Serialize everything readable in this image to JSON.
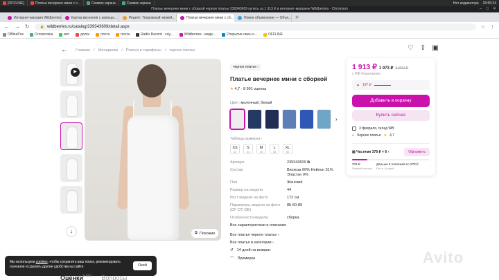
{
  "os": {
    "tasks": [
      "[OFFLINE]",
      "Платье вечернее мини с с...",
      "Снимок экрана",
      "Снимок экрана"
    ],
    "indicator": "Нет индикатора",
    "time": "18:55:24"
  },
  "window": {
    "title": "Платье вечернее мини с сборкой черное платье 239343609 купить за 1 913 ₽ в интернет-магазине Wildberries - Chromium"
  },
  "tabs": [
    {
      "label": "Интернет-магазин Wildberries"
    },
    {
      "label": "Куртка весенняя с капюшо..."
    },
    {
      "label": "Рецепт: Творожный чизкей..."
    },
    {
      "label": "Платье вечернее мини с сб..."
    },
    {
      "label": "Новое объявление — Объя..."
    }
  ],
  "address": {
    "url": "wildberries.ru/catalog/239343609/detail.aspx"
  },
  "bookmarks": [
    "OfflinePos",
    "Статистика",
    "вит",
    "долги",
    "почта",
    "почта",
    "Radio Record - слу...",
    "Wildberries - моде...",
    "Открытие смен о...",
    "OFFLINE"
  ],
  "breadcrumbs": [
    "Главная",
    "Женщинам",
    "Платья и сарафаны",
    "черное платье"
  ],
  "product": {
    "badge": "черное платье",
    "title": "Платье вечернее мини с сборкой",
    "rating": "4,7",
    "reviews": "8 991 оценка",
    "color_label": "Цвет:",
    "color_value": "молочный, белый",
    "swatch_colors": [
      "#eeeeee",
      "#243a62",
      "#1f2e52",
      "#5c7fb8",
      "#2e58b5",
      "#6fa6c8"
    ],
    "size_table": "Таблица размеров",
    "sizes": [
      {
        "label": "XS",
        "ru": "42"
      },
      {
        "label": "S",
        "ru": "44"
      },
      {
        "label": "M",
        "ru": "46"
      },
      {
        "label": "L",
        "ru": "48"
      },
      {
        "label": "XL",
        "ru": "50"
      }
    ],
    "specs": [
      {
        "k": "Артикул",
        "v": "239343609"
      },
      {
        "k": "Состав",
        "v": "Вискоза 60% Нейлон 31% Эластан 9%"
      },
      {
        "k": "Пол",
        "v": "Женский"
      },
      {
        "k": "Размер на модели",
        "v": "44"
      },
      {
        "k": "Рост модели на фото",
        "v": "172 см"
      },
      {
        "k": "Параметры модели на фото (ОГ-ОТ-ОБ)",
        "v": "85-60-89"
      },
      {
        "k": "Особенности модели",
        "v": "сборка"
      }
    ],
    "all_chars": "Все характеристики и описание",
    "link1": "Все платья черное платье",
    "link2": "Все платья в категории",
    "return": "14 дней на возврат",
    "fitting": "Примерка",
    "similar": "Похожие"
  },
  "buy": {
    "price": "1 913 ₽",
    "wallet_price": "1 973 ₽",
    "old_price": "3 892 ₽",
    "wallet": "с WB Кошельком",
    "drop": "197 ₽",
    "cart": "Добавить в корзину",
    "buy_now": "Купить сейчас",
    "delivery": "3 февраля, склад WB",
    "seller": "Черное платье",
    "seller_rating": "4,7",
    "parts_label": "Частями 378 ₽ × 6",
    "form_btn": "Оформить",
    "parts_progress": 0.2,
    "parts": [
      {
        "top": "378 ₽",
        "bottom": "Первый платёж"
      },
      {
        "top": "Дальше 5 платежей по 378 ₽",
        "bottom": "Раз в 14 дней"
      }
    ],
    "brand_color": "#cb11ab"
  },
  "cookie": {
    "text1": "Мы используем",
    "link": "cookies",
    "text2": ", чтобы сохранять ваш поиск, рекомендовать полезное и сделать другие удобства на сайте",
    "ok": "Окей"
  },
  "bottom": {
    "reviews": "Оценки",
    "reviews_count": "8 991",
    "questions": "Вопросы"
  },
  "watermark": "Avito"
}
